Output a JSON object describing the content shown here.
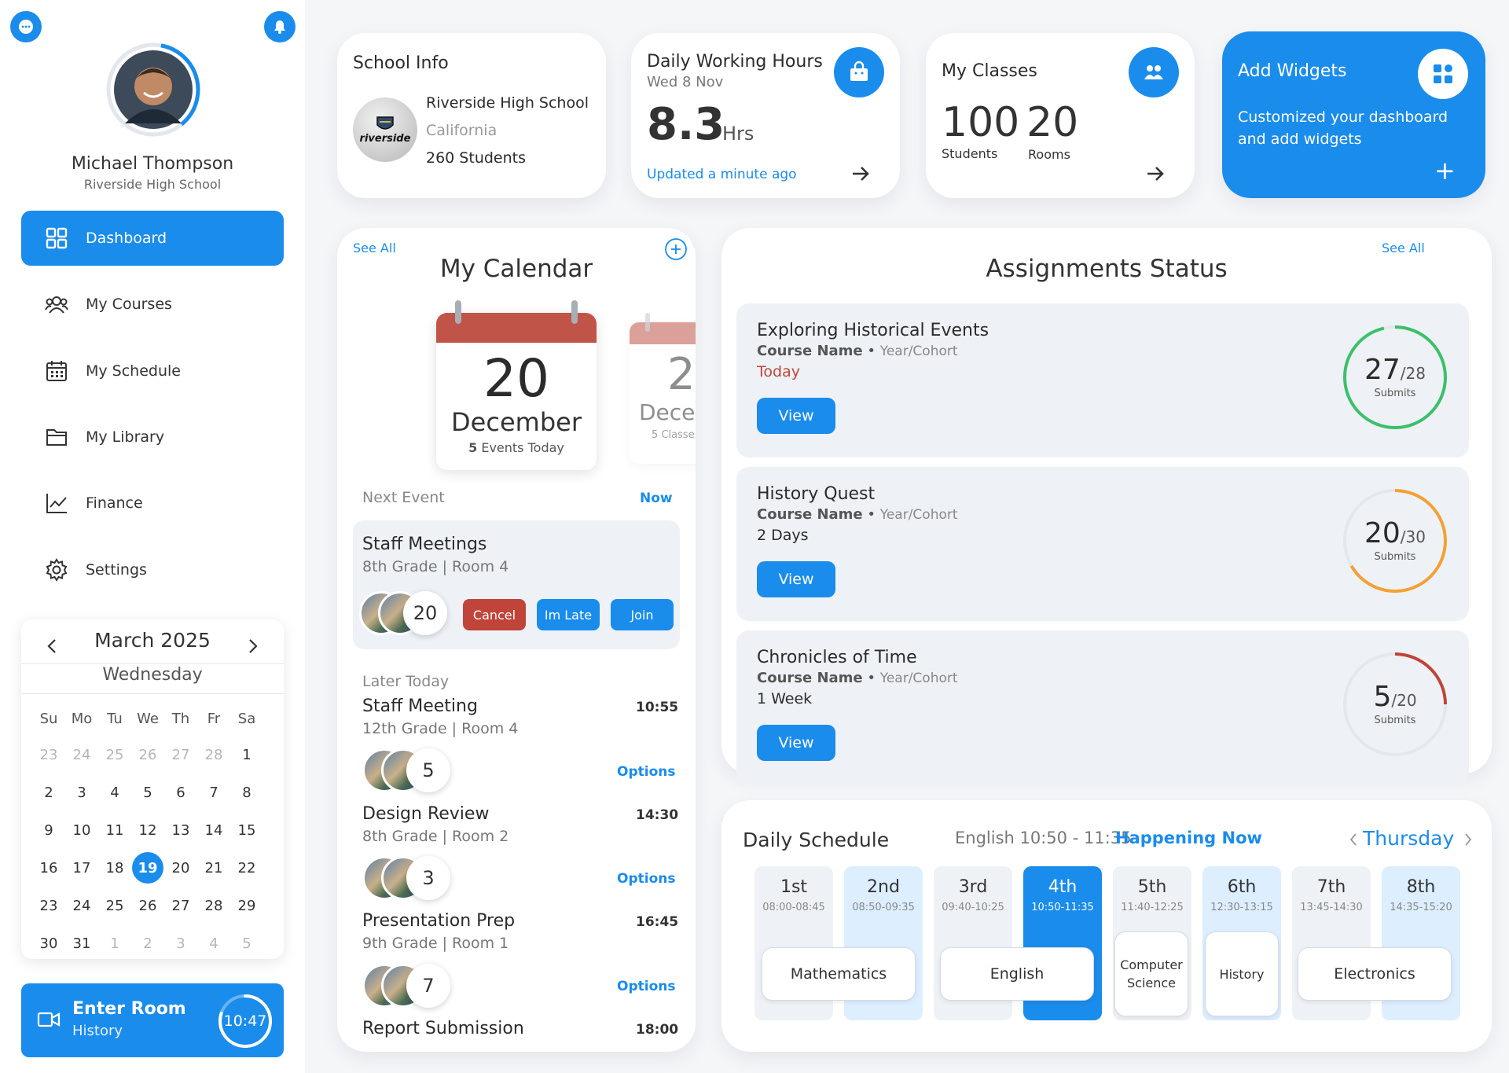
{
  "sidebar": {
    "user": {
      "name": "Michael Thompson",
      "school": "Riverside High School"
    },
    "nav": [
      {
        "label": "Dashboard",
        "icon": "dashboard-icon",
        "active": true
      },
      {
        "label": "My Courses",
        "icon": "users-icon"
      },
      {
        "label": "My Schedule",
        "icon": "calendar-icon"
      },
      {
        "label": "My Library",
        "icon": "folder-icon"
      },
      {
        "label": "Finance",
        "icon": "chart-line-icon"
      },
      {
        "label": "Settings",
        "icon": "gear-icon"
      }
    ],
    "mini_calendar": {
      "month": "March 2025",
      "weekday": "Wednesday",
      "headers": [
        "Su",
        "Mo",
        "Tu",
        "We",
        "Th",
        "Fr",
        "Sa"
      ],
      "days": [
        [
          "23",
          "24",
          "25",
          "26",
          "27",
          "28",
          "1"
        ],
        [
          "2",
          "3",
          "4",
          "5",
          "6",
          "7",
          "8"
        ],
        [
          "9",
          "10",
          "11",
          "12",
          "13",
          "14",
          "15"
        ],
        [
          "16",
          "17",
          "18",
          "19",
          "20",
          "21",
          "22"
        ],
        [
          "23",
          "24",
          "25",
          "26",
          "27",
          "28",
          "29"
        ],
        [
          "30",
          "31",
          "1",
          "2",
          "3",
          "4",
          "5"
        ]
      ],
      "selected": "19"
    },
    "enter_room": {
      "label": "Enter Room",
      "sub": "History",
      "time": "10:47",
      "progress": 0.8
    }
  },
  "school_info": {
    "title": "School Info",
    "logo_text": "riverside",
    "name": "Riverside High School",
    "state": "California",
    "students": "260 Students"
  },
  "working_hours": {
    "title": "Daily Working Hours",
    "date": "Wed 8 Nov",
    "value": "8.3",
    "unit": "Hrs",
    "updated": "Updated a minute ago"
  },
  "my_classes": {
    "title": "My Classes",
    "students_value": "100",
    "students_label": "Students",
    "rooms_value": "20",
    "rooms_label": "Rooms"
  },
  "add_widgets": {
    "title": "Add Widgets",
    "desc": "Customized your dashboard and add widgets",
    "plus": "+"
  },
  "calendar": {
    "see_all": "See All",
    "title": "My Calendar",
    "card_day": "20",
    "card_month": "December",
    "card_events_n": "5",
    "card_events_label": "Events Today",
    "peek_day": "2",
    "peek_month": "Dece",
    "peek_sub": "5 Classe",
    "next_event_label": "Next Event",
    "now_label": "Now",
    "next_event": {
      "title": "Staff Meetings",
      "sub": "8th Grade | Room 4",
      "count": "20",
      "cancel": "Cancel",
      "late": "Im Late",
      "join": "Join"
    },
    "later_today_label": "Later Today",
    "options_label": "Options",
    "later": [
      {
        "title": "Staff Meeting",
        "sub": "12th Grade | Room 4",
        "time": "10:55",
        "count": "5"
      },
      {
        "title": "Design Review",
        "sub": "8th Grade | Room 2",
        "time": "14:30",
        "count": "3"
      },
      {
        "title": "Presentation Prep",
        "sub": "9th Grade | Room 1",
        "time": "16:45",
        "count": "7"
      },
      {
        "title": "Report Submission",
        "sub": "",
        "time": "18:00",
        "count": ""
      }
    ]
  },
  "assignments": {
    "title": "Assignments Status",
    "see_all": "See All",
    "course_label": "Course Name",
    "cohort_label": "Year/Cohort",
    "view_label": "View",
    "submits_label": "Submits",
    "items": [
      {
        "title": "Exploring Historical Events",
        "due": "Today",
        "done": "27",
        "total": "28",
        "color": "#3cc06a",
        "due_color": "#c0443a"
      },
      {
        "title": "History Quest",
        "due": "2 Days",
        "done": "20",
        "total": "30",
        "color": "#f5a033",
        "due_color": "#2b2b2b"
      },
      {
        "title": "Chronicles of Time",
        "due": "1 Week",
        "done": "5",
        "total": "20",
        "color": "#c0443a",
        "due_color": "#2b2b2b"
      }
    ]
  },
  "schedule": {
    "title": "Daily Schedule",
    "current": "English 10:50 - 11:35",
    "happening": "Happening Now",
    "day": "Thursday",
    "periods": [
      {
        "name": "1st",
        "time": "08:00-08:45"
      },
      {
        "name": "2nd",
        "time": "08:50-09:35"
      },
      {
        "name": "3rd",
        "time": "09:40-10:25"
      },
      {
        "name": "4th",
        "time": "10:50-11:35"
      },
      {
        "name": "5th",
        "time": "11:40-12:25"
      },
      {
        "name": "6th",
        "time": "12:30-13:15"
      },
      {
        "name": "7th",
        "time": "13:45-14:30"
      },
      {
        "name": "8th",
        "time": "14:35-15:20"
      }
    ],
    "subjects": [
      "Mathematics",
      "English",
      "Computer Science",
      "History",
      "Electronics"
    ]
  },
  "colors": {
    "accent": "#1a8cec",
    "danger": "#c0443a",
    "success": "#3cc06a",
    "warning": "#f5a033"
  }
}
